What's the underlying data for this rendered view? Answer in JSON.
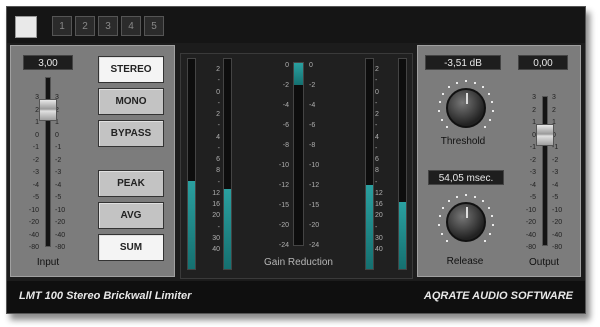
{
  "presets": {
    "active": "",
    "slots": [
      "1",
      "2",
      "3",
      "4",
      "5"
    ]
  },
  "input": {
    "value": "3,00",
    "caption": "Input",
    "level": 3.0,
    "scale_left": [
      "3",
      "2",
      "1",
      "0",
      "-1",
      "-2",
      "-3",
      "-4",
      "-5",
      "-10",
      "-20",
      "-40",
      "-80"
    ],
    "scale_right": [
      "3",
      "2",
      "1",
      "0",
      "-1",
      "-2",
      "-3",
      "-4",
      "-5",
      "-10",
      "-20",
      "-40",
      "-80"
    ]
  },
  "mode_buttons": [
    {
      "label": "STEREO",
      "active": true
    },
    {
      "label": "MONO",
      "active": false
    },
    {
      "label": "BYPASS",
      "active": false
    }
  ],
  "detect_buttons": [
    {
      "label": "PEAK",
      "active": false
    },
    {
      "label": "AVG",
      "active": false
    },
    {
      "label": "SUM",
      "active": true
    }
  ],
  "meters": {
    "scale": [
      "2",
      "-",
      "0",
      "-",
      "2",
      "-",
      "4",
      "-",
      "6",
      "8",
      "-",
      "12",
      "16",
      "20",
      "-",
      "30",
      "40"
    ],
    "left_in_level": 0.42,
    "right_in_level": 0.38,
    "left_out_level": 0.4,
    "right_out_level": 0.32
  },
  "gain_reduction": {
    "caption": "Gain Reduction",
    "scale": [
      "0",
      "-2",
      "-4",
      "-6",
      "-8",
      "-10",
      "-12",
      "-15",
      "-20",
      "-24"
    ],
    "level": 0.12
  },
  "threshold": {
    "value": "-3,51 dB",
    "caption": "Threshold"
  },
  "release": {
    "value": "54,05 msec.",
    "caption": "Release"
  },
  "output": {
    "value": "0,00",
    "caption": "Output",
    "level": 0.0,
    "scale": [
      "3",
      "2",
      "1",
      "0",
      "-1",
      "-2",
      "-3",
      "-4",
      "-5",
      "-10",
      "-20",
      "-40",
      "-80"
    ]
  },
  "footer": {
    "product": "LMT 100 Stereo Brickwall Limiter",
    "vendor": "AQRATE AUDIO SOFTWARE"
  },
  "colors": {
    "meter_fill": "#1f8c8c",
    "background": "#1c1c1c",
    "panel": "#7c7c7c"
  }
}
